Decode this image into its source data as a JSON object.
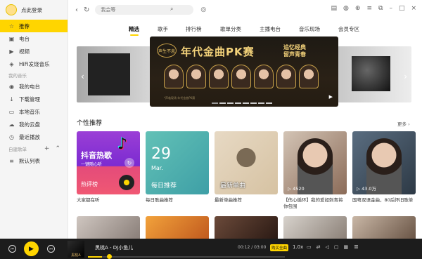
{
  "sidebar": {
    "login_label": "点此登录",
    "items": [
      {
        "label": "推荐",
        "icon": "star-icon"
      },
      {
        "label": "电台",
        "icon": "radio-icon"
      },
      {
        "label": "视频",
        "icon": "video-icon"
      },
      {
        "label": "HiFi发烧音乐",
        "icon": "hifi-icon"
      }
    ],
    "my_music_title": "我的音乐",
    "my_items": [
      {
        "label": "我的电台",
        "icon": "radio-icon"
      },
      {
        "label": "下载管理",
        "icon": "download-icon"
      },
      {
        "label": "本地音乐",
        "icon": "local-music-icon"
      },
      {
        "label": "我的云盘",
        "icon": "cloud-icon"
      },
      {
        "label": "最近播放",
        "icon": "clock-icon"
      }
    ],
    "playlists_title": "自建歌单",
    "playlists": [
      {
        "label": "默认列表"
      }
    ]
  },
  "topbar": {
    "search_placeholder": "我会等"
  },
  "tabs": [
    "精选",
    "歌手",
    "排行榜",
    "歌单分类",
    "主播电台",
    "音乐现场",
    "会员专区"
  ],
  "active_tab": "精选",
  "banner": {
    "badge": "声生不息",
    "title": "年代金曲PK赛",
    "subtitle_1": "追忆经典",
    "subtitle_2": "留声青春",
    "note": "*声临现场·年代金曲PK赛"
  },
  "section": {
    "title": "个性推荐",
    "more": "更多 ›"
  },
  "cards": [
    {
      "title": "大家都在听",
      "big": "抖音热歌",
      "small": "一键随心听",
      "bottom": "热评榜"
    },
    {
      "title": "每日歌曲推荐",
      "day": "29",
      "month": "Mar.",
      "label": "每日推荐"
    },
    {
      "title": "最新单曲推荐",
      "label": "最新单曲"
    },
    {
      "title": "【伤心循环】我的爱如刺青将你包围",
      "count": "4520"
    },
    {
      "title": "国粤双语金曲，80后怀旧歌单",
      "count": "43.0万"
    }
  ],
  "player": {
    "song": "黑桃A - DJ小鱼儿",
    "time": "00:12 / 03:00",
    "badge": "购买全曲",
    "speed": "1.0x",
    "cover_text": "黑桃A",
    "progress": 0.07
  }
}
